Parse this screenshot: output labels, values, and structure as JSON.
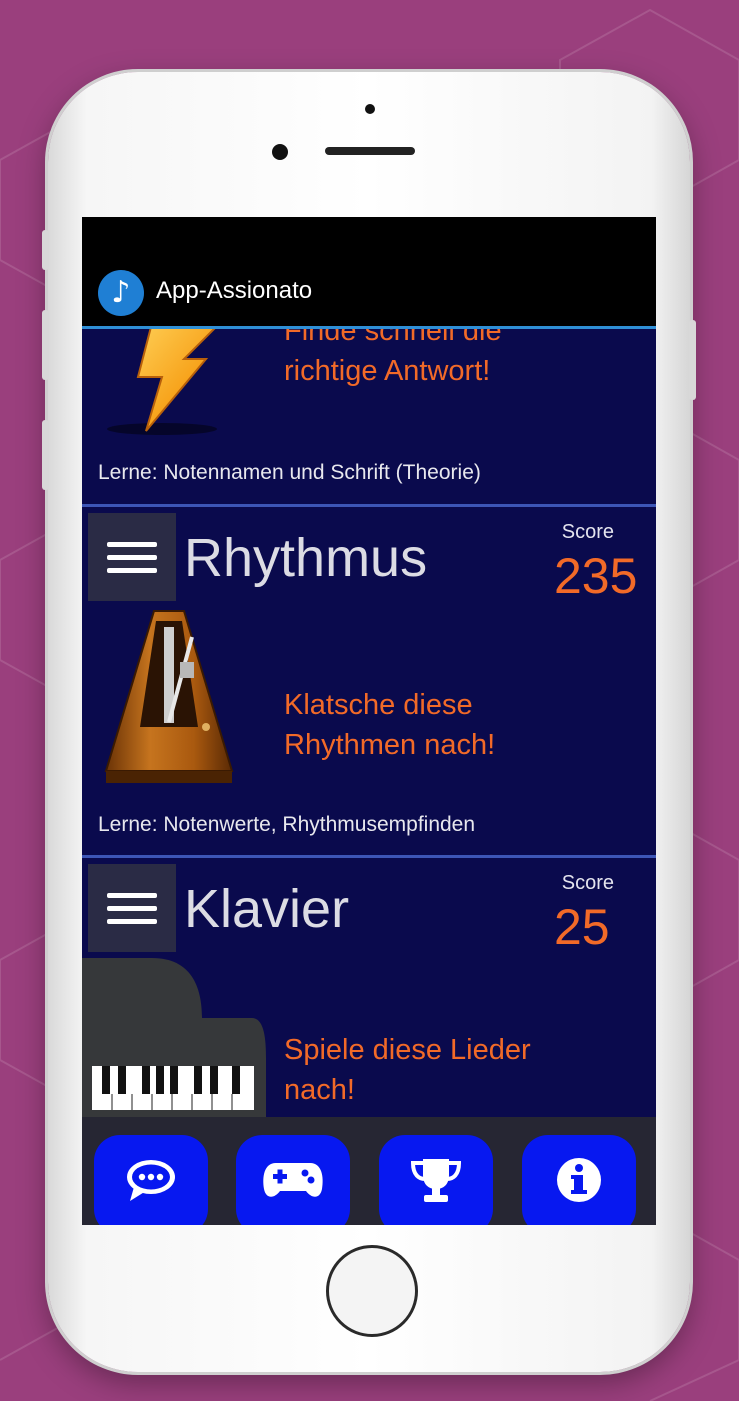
{
  "app": {
    "title": "App-Assionato",
    "icon": "music-note-icon"
  },
  "cards": [
    {
      "id": "notes",
      "description": [
        "Finde schnell die",
        "richtige Antwort!"
      ],
      "learn": "Lerne: Notennamen und Schrift (Theorie)",
      "image": "lightning-icon"
    },
    {
      "id": "rhythm",
      "title": "Rhythmus",
      "score_label": "Score",
      "score": "235",
      "description": [
        "Klatsche diese",
        "Rhythmen nach!"
      ],
      "learn": "Lerne: Notenwerte, Rhythmusempfinden",
      "image": "metronome-icon"
    },
    {
      "id": "piano",
      "title": "Klavier",
      "score_label": "Score",
      "score": "25",
      "description": [
        "Spiele diese Lieder",
        "nach!"
      ],
      "image": "grand-piano-icon"
    }
  ],
  "bottom_nav": [
    {
      "icon": "chat-icon"
    },
    {
      "icon": "gamepad-icon"
    },
    {
      "icon": "trophy-icon"
    },
    {
      "icon": "info-icon"
    }
  ],
  "colors": {
    "background": "#9a3f7d",
    "screen": "#0a0a4d",
    "accent_orange": "#f26a28",
    "nav_blue": "#0718f0",
    "separator": "#3d56b6"
  }
}
